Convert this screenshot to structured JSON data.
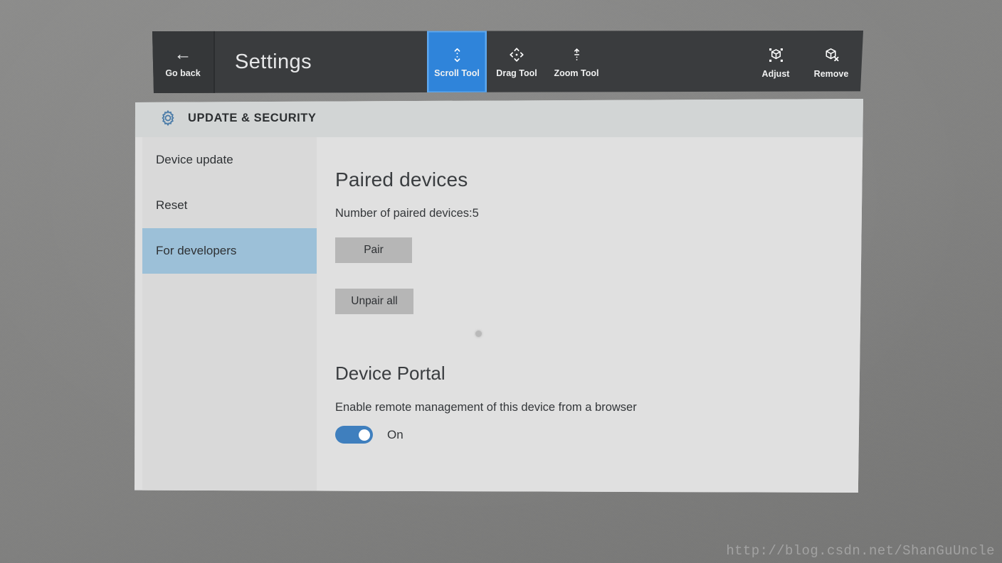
{
  "app": {
    "title": "Settings",
    "background_color": "#848484"
  },
  "toolbar": {
    "back": {
      "label": "Go back",
      "icon": "arrow-left-icon"
    },
    "tools": [
      {
        "label": "Scroll Tool",
        "icon": "scroll-tool-icon",
        "active": true
      },
      {
        "label": "Drag Tool",
        "icon": "drag-tool-icon",
        "active": false
      },
      {
        "label": "Zoom Tool",
        "icon": "zoom-tool-icon",
        "active": false
      }
    ],
    "actions": [
      {
        "label": "Adjust",
        "icon": "adjust-cube-icon"
      },
      {
        "label": "Remove",
        "icon": "remove-cube-icon"
      }
    ],
    "active_accent_color": "#2f84da",
    "bar_color": "#3a3c3e"
  },
  "panel": {
    "header": {
      "icon": "gear-icon",
      "title": "UPDATE & SECURITY",
      "icon_color": "#4a7ba8"
    },
    "sidebar": {
      "items": [
        {
          "label": "Device update",
          "selected": false
        },
        {
          "label": "Reset",
          "selected": false
        },
        {
          "label": "For developers",
          "selected": true
        }
      ],
      "selected_color": "#9cc0d8"
    },
    "content": {
      "paired_devices": {
        "title": "Paired devices",
        "count_label": "Number of paired devices:5",
        "pair_button": "Pair",
        "unpair_all_button": "Unpair all"
      },
      "device_portal": {
        "title": "Device Portal",
        "description": "Enable remote management of this device from a browser",
        "toggle_state": "On",
        "toggle_on": true,
        "toggle_color": "#3f7fbe"
      }
    }
  },
  "watermark": {
    "text": "http://blog.csdn.net/ShanGuUncle"
  }
}
